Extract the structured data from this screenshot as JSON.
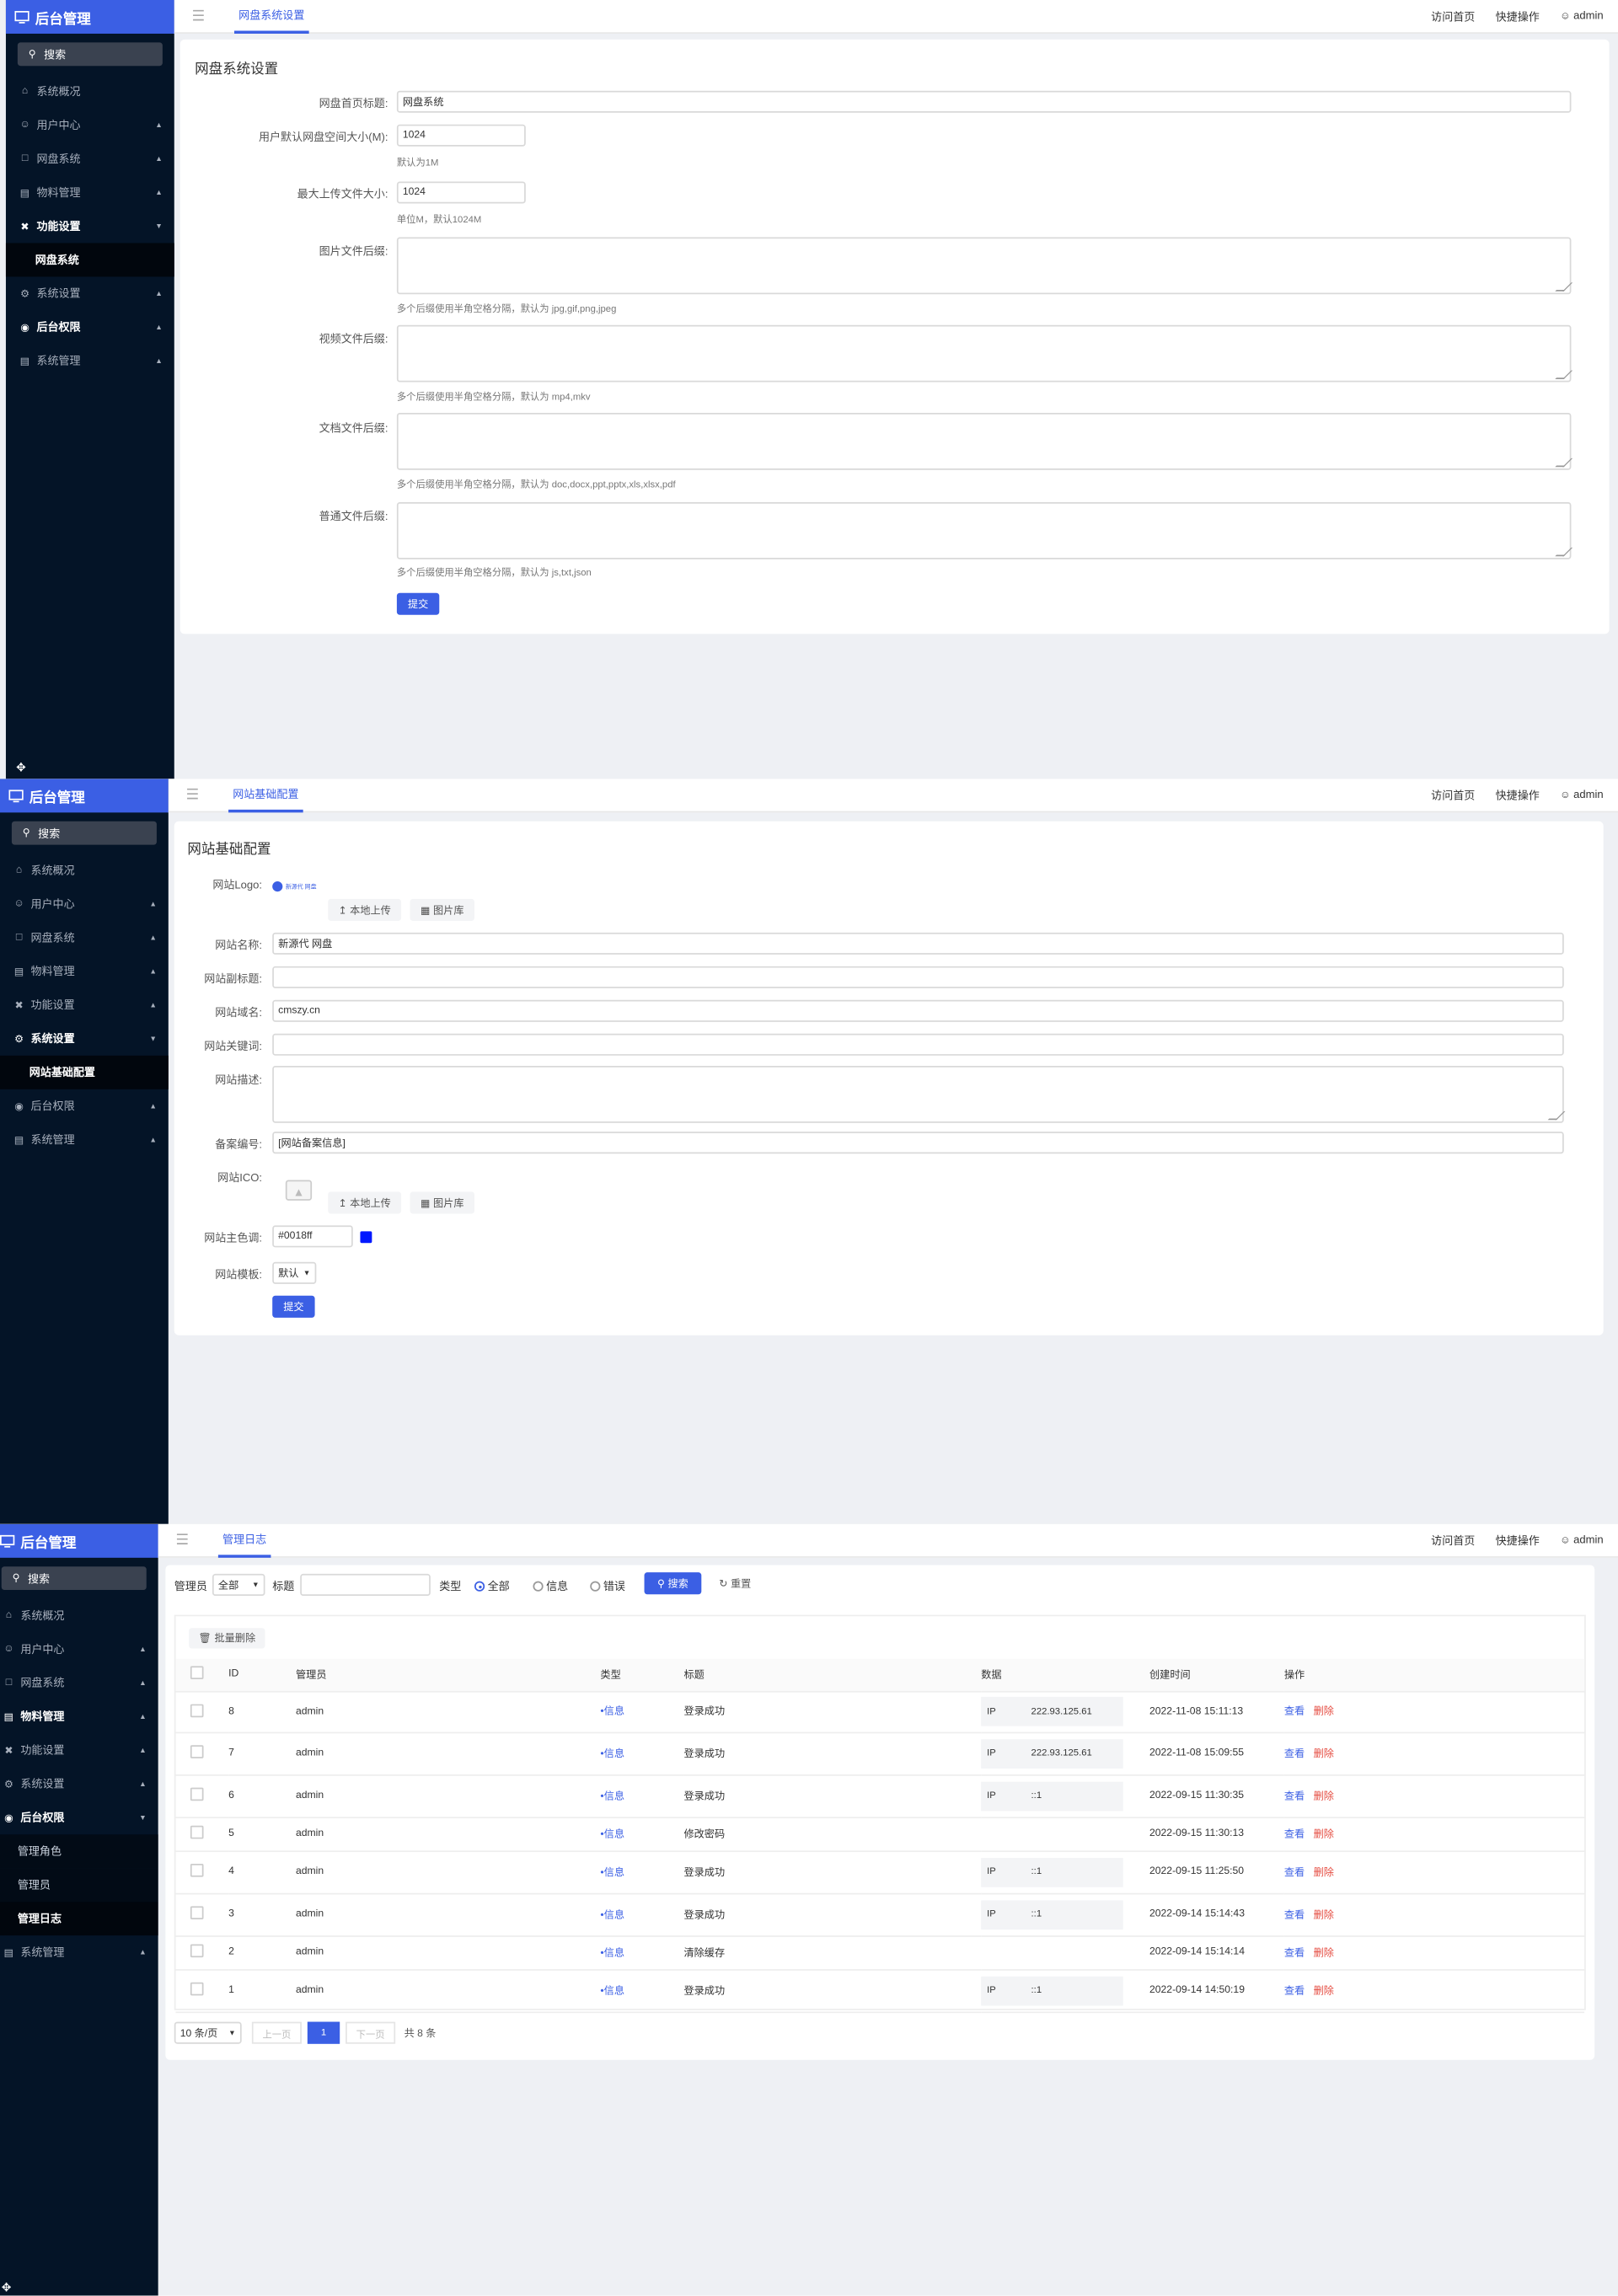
{
  "common": {
    "brand": "后台管理",
    "search_label": "搜索",
    "top_visit": "访问首页",
    "top_quick": "快捷操作",
    "top_user": "admin",
    "nav": {
      "overview": "系统概况",
      "user_center": "用户中心",
      "disk_system": "网盘系统",
      "material": "物料管理",
      "feature": "功能设置",
      "system_settings": "系统设置",
      "permissions": "后台权限",
      "system_manage": "系统管理"
    }
  },
  "panel1": {
    "tab": "网盘系统设置",
    "nav_sub_label": "网盘系统",
    "card_title": "网盘系统设置",
    "fields": {
      "home_title_label": "网盘首页标题:",
      "home_title_value": "网盘系统",
      "space_label": "用户默认网盘空间大小(M):",
      "space_value": "1024",
      "space_hint": "默认为1M",
      "upload_label": "最大上传文件大小:",
      "upload_value": "1024",
      "upload_hint": "单位M，默认1024M",
      "image_label": "图片文件后缀:",
      "image_hint": "多个后缀使用半角空格分隔，默认为 jpg,gif,png,jpeg",
      "video_label": "视频文件后缀:",
      "video_hint": "多个后缀使用半角空格分隔，默认为 mp4,mkv",
      "doc_label": "文档文件后缀:",
      "doc_hint": "多个后缀使用半角空格分隔，默认为 doc,docx,ppt,pptx,xls,xlsx,pdf",
      "common_label": "普通文件后缀:",
      "common_hint": "多个后缀使用半角空格分隔，默认为 js,txt,json"
    },
    "submit": "提交"
  },
  "panel2": {
    "tab": "网站基础配置",
    "nav_sub_label": "网站基础配置",
    "card_title": "网站基础配置",
    "logo_label": "网站Logo:",
    "logo_text": "新源代 网盘",
    "upload_local": "本地上传",
    "image_library": "图片库",
    "name_label": "网站名称:",
    "name_value": "新源代 网盘",
    "subtitle_label": "网站副标题:",
    "domain_label": "网站域名:",
    "domain_value": "cmszy.cn",
    "keywords_label": "网站关键词:",
    "desc_label": "网站描述:",
    "icp_label": "备案编号:",
    "icp_value": "[网站备案信息]",
    "ico_label": "网站ICO:",
    "color_label": "网站主色调:",
    "color_value": "#0018ff",
    "color_hex": "#0018ff",
    "template_label": "网站模板:",
    "template_value": "默认",
    "submit": "提交"
  },
  "panel3": {
    "tab": "管理日志",
    "nav_subs": [
      "管理角色",
      "管理员",
      "管理日志"
    ],
    "filter": {
      "admin_label": "管理员",
      "admin_value": "全部",
      "title_label": "标题",
      "type_label": "类型",
      "radio_all": "全部",
      "radio_info": "信息",
      "radio_error": "错误",
      "search_btn": "搜索",
      "reset_btn": "重置"
    },
    "batch_delete": "批量删除",
    "columns": [
      "ID",
      "管理员",
      "类型",
      "标题",
      "数据",
      "创建时间",
      "操作"
    ],
    "rows": [
      {
        "id": "8",
        "admin": "admin",
        "type": "信息",
        "title": "登录成功",
        "ip_label": "IP",
        "ip": "222.93.125.61",
        "time": "2022-11-08 15:11:13"
      },
      {
        "id": "7",
        "admin": "admin",
        "type": "信息",
        "title": "登录成功",
        "ip_label": "IP",
        "ip": "222.93.125.61",
        "time": "2022-11-08 15:09:55"
      },
      {
        "id": "6",
        "admin": "admin",
        "type": "信息",
        "title": "登录成功",
        "ip_label": "IP",
        "ip": "::1",
        "time": "2022-09-15 11:30:35"
      },
      {
        "id": "5",
        "admin": "admin",
        "type": "信息",
        "title": "修改密码",
        "ip_label": "",
        "ip": "",
        "time": "2022-09-15 11:30:13"
      },
      {
        "id": "4",
        "admin": "admin",
        "type": "信息",
        "title": "登录成功",
        "ip_label": "IP",
        "ip": "::1",
        "time": "2022-09-15 11:25:50"
      },
      {
        "id": "3",
        "admin": "admin",
        "type": "信息",
        "title": "登录成功",
        "ip_label": "IP",
        "ip": "::1",
        "time": "2022-09-14 15:14:43"
      },
      {
        "id": "2",
        "admin": "admin",
        "type": "信息",
        "title": "清除缓存",
        "ip_label": "",
        "ip": "",
        "time": "2022-09-14 15:14:14"
      },
      {
        "id": "1",
        "admin": "admin",
        "type": "信息",
        "title": "登录成功",
        "ip_label": "IP",
        "ip": "::1",
        "time": "2022-09-14 14:50:19"
      }
    ],
    "action_view": "查看",
    "action_delete": "删除",
    "pagination": {
      "page_size": "10 条/页",
      "prev": "上一页",
      "current": "1",
      "next": "下一页",
      "total": "共 8 条"
    }
  }
}
